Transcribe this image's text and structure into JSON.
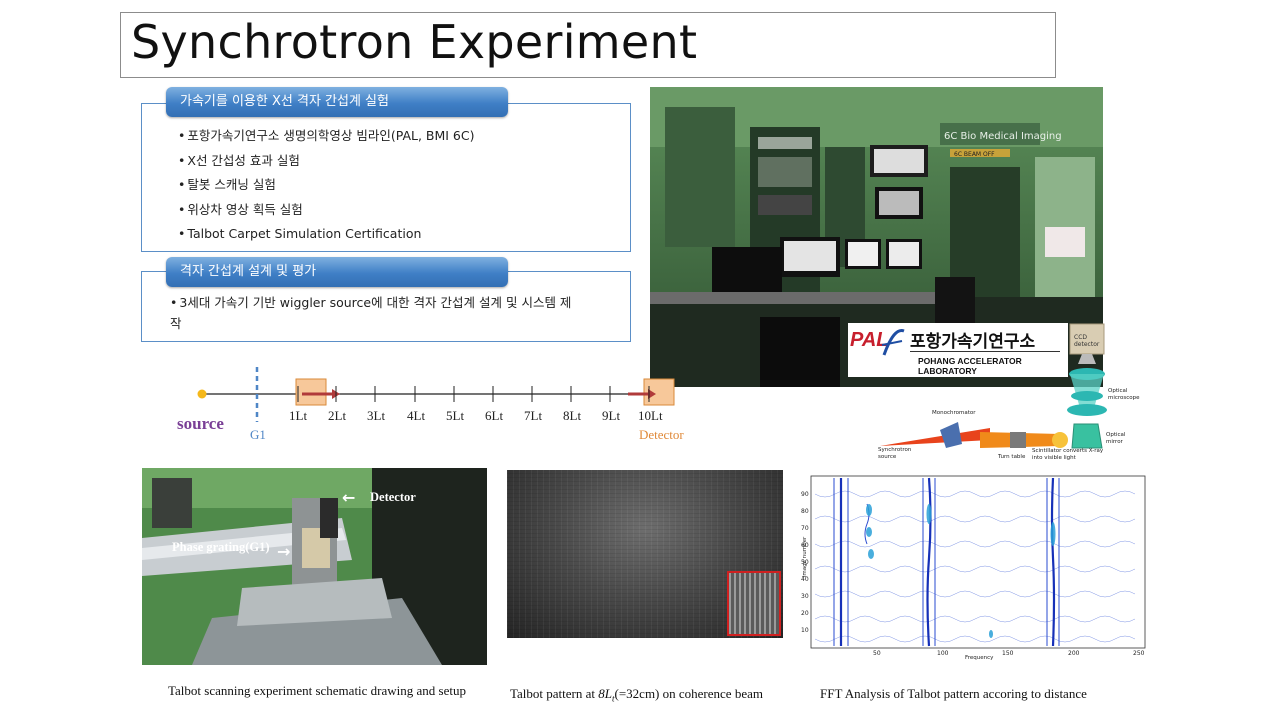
{
  "title": "Synchrotron Experiment",
  "section1": {
    "heading": "가속기를 이용한 X선 격자 간섭계 실험",
    "items": [
      "포항가속기연구소 생명의학영상 빔라인(PAL, BMI 6C)",
      "X선 간섭성 효과 실험",
      "탈봇 스캐닝 실험",
      "위상차 영상 획득 실험",
      "Talbot Carpet Simulation Certification"
    ]
  },
  "section2": {
    "heading": "격자 간섭계 설계 및 평가",
    "items": [
      "3세대 가속기 기반 wiggler source에 대한 격자 간섭계 설계 및 시스템 제작"
    ]
  },
  "photo_control_room": {
    "sign": "6C Bio Medical Imaging",
    "sign_sub": "6C  BEAM  OFF"
  },
  "pal_logo": {
    "mark": "PAL",
    "korean": "포항가속기연구소",
    "english": "POHANG ACCELERATOR LABORATORY"
  },
  "beamline_diagram": {
    "ccd": "CCD detector",
    "microscope": "Optical microscope",
    "mirror": "Optical mirror",
    "monochromator": "Monochromator",
    "source": "Synchrotron source",
    "turntable": "Turn table",
    "scintillator": "Scintillator converts X-ray into visible light"
  },
  "timeline": {
    "source_label": "source",
    "g1_label": "G1",
    "ticks": [
      "1Lt",
      "2Lt",
      "3Lt",
      "4Lt",
      "5Lt",
      "6Lt",
      "7Lt",
      "8Lt",
      "9Lt",
      "10Lt"
    ],
    "detector_label": "Detector"
  },
  "setup_photo": {
    "detector": "Detector",
    "grating": "Phase grating(G1)"
  },
  "fft_plot": {
    "xlabel": "Frequency",
    "ylabel": "Image number",
    "xticks": [
      "50",
      "100",
      "150",
      "200",
      "250"
    ],
    "yticks": [
      "10",
      "20",
      "30",
      "40",
      "50",
      "60",
      "70",
      "80",
      "90"
    ]
  },
  "captions": {
    "setup": "Talbot scanning experiment schematic drawing and setup",
    "pattern_prefix": "Talbot pattern at ",
    "pattern_math_base": "8L",
    "pattern_math_sub": "t",
    "pattern_suffix": "(=32cm) on coherence beam",
    "fft": "FFT Analysis of Talbot pattern accoring to distance"
  }
}
